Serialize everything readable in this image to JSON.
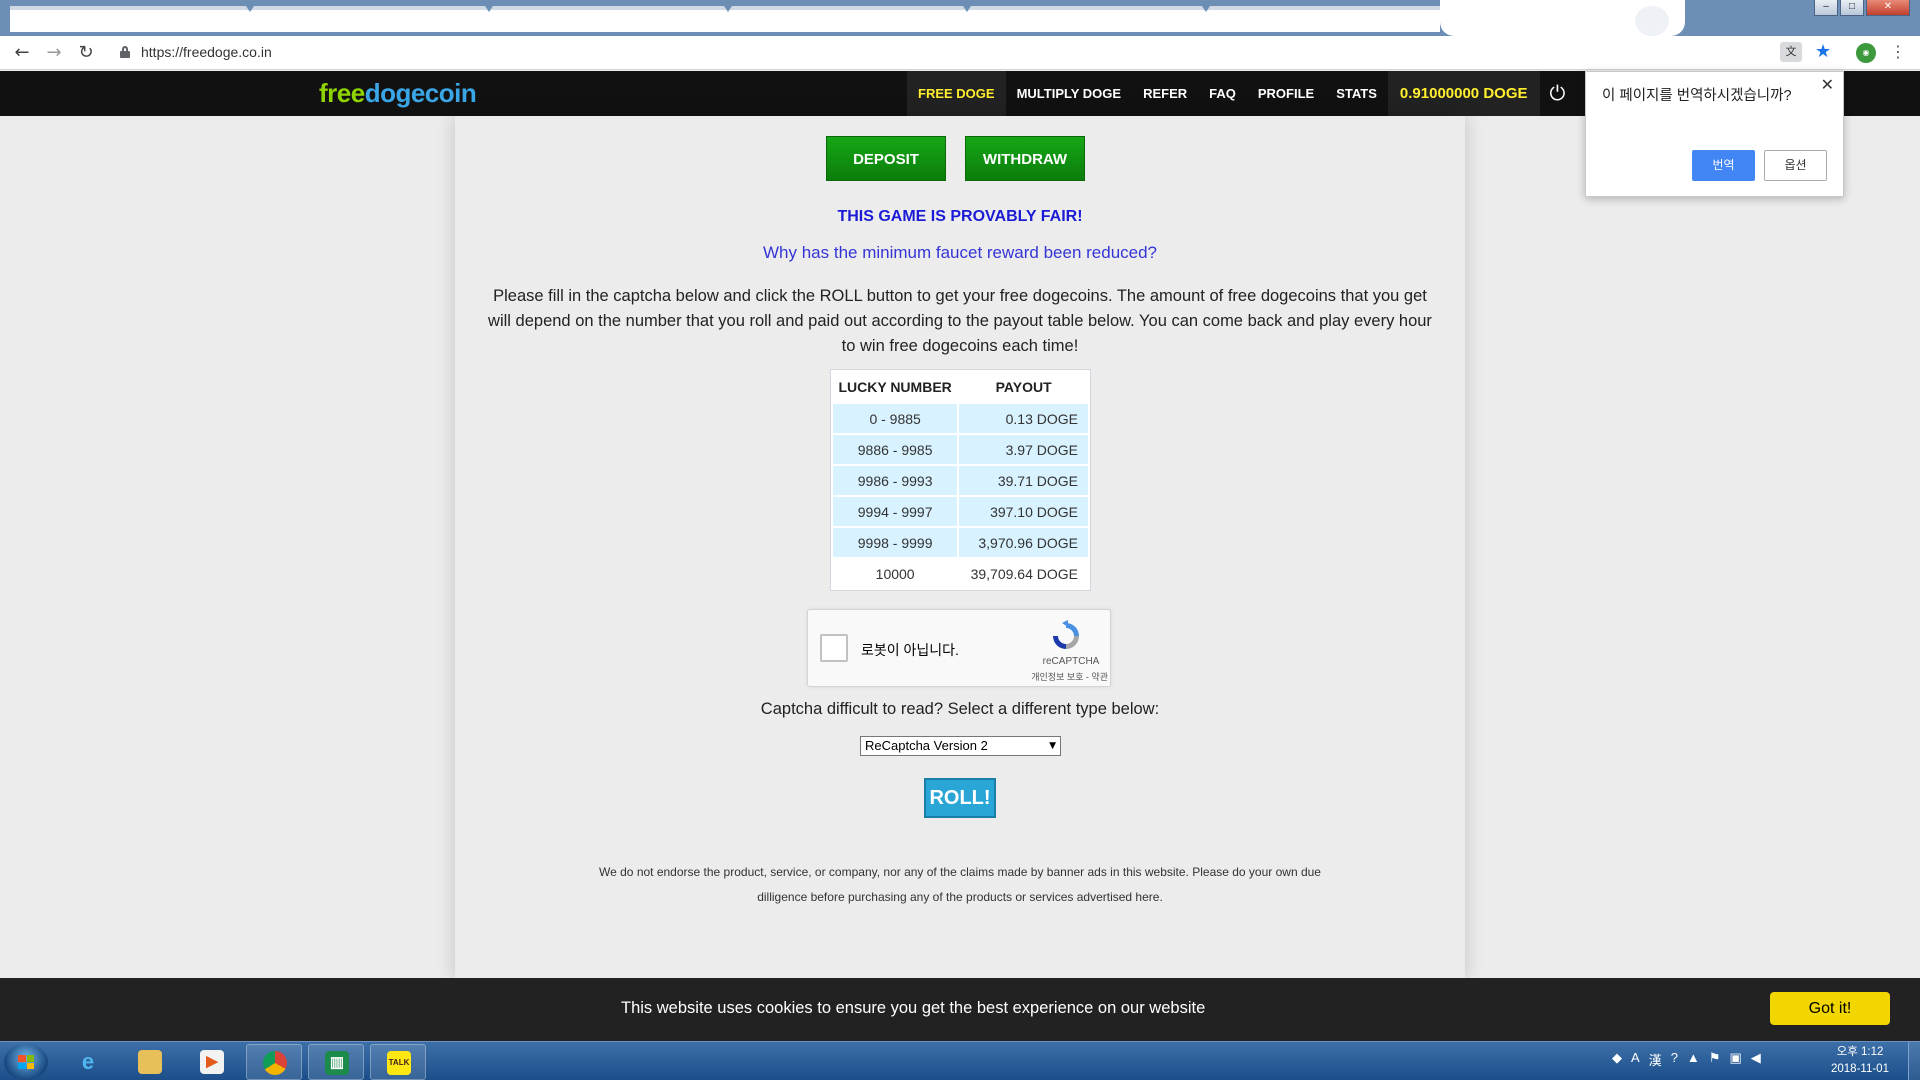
{
  "browser": {
    "url": "https://freedoge.co.in",
    "window_controls": [
      "–",
      "□",
      "✕"
    ]
  },
  "site": {
    "logo_part1": "free",
    "logo_part2": "dogecoin",
    "nav": [
      "FREE DOGE",
      "MULTIPLY DOGE",
      "REFER",
      "FAQ",
      "PROFILE",
      "STATS"
    ],
    "balance": "0.91000000 DOGE"
  },
  "main": {
    "deposit_label": "DEPOSIT",
    "withdraw_label": "WITHDRAW",
    "provably_fair": "THIS GAME IS PROVABLY FAIR!",
    "reduced_link": "Why has the minimum faucet reward been reduced?",
    "intro": "Please fill in the captcha below and click the ROLL button to get your free dogecoins. The amount of free dogecoins that you get will depend on the number that you roll and paid out according to the payout table below. You can come back and play every hour to win free dogecoins each time!",
    "table": {
      "headers": [
        "LUCKY NUMBER",
        "PAYOUT"
      ],
      "rows": [
        [
          "0 - 9885",
          "0.13 DOGE"
        ],
        [
          "9886 - 9985",
          "3.97 DOGE"
        ],
        [
          "9986 - 9993",
          "39.71 DOGE"
        ],
        [
          "9994 - 9997",
          "397.10 DOGE"
        ],
        [
          "9998 - 9999",
          "3,970.96 DOGE"
        ],
        [
          "10000",
          "39,709.64 DOGE"
        ]
      ]
    },
    "recaptcha": {
      "label": "로봇이 아닙니다.",
      "brand": "reCAPTCHA",
      "terms": "개인정보 보호 - 약관"
    },
    "captcha_question": "Captcha difficult to read? Select a different type below:",
    "captcha_select": "ReCaptcha Version 2",
    "roll_label": "ROLL!",
    "disclaimer_line1": "We do not endorse the product, service, or company, nor any of the claims made by banner ads in this website. Please do your own due",
    "disclaimer_line2": "dilligence before purchasing any of the products or services advertised here."
  },
  "translate_popup": {
    "question": "이 페이지를 번역하시겠습니까?",
    "translate_button": "번역",
    "options_button": "옵션"
  },
  "cookie_bar": {
    "message": "This website uses cookies to ensure you get the best experience on our website",
    "button": "Got it!"
  },
  "taskbar": {
    "clock_time": "오후 1:12",
    "clock_date": "2018-11-01"
  }
}
